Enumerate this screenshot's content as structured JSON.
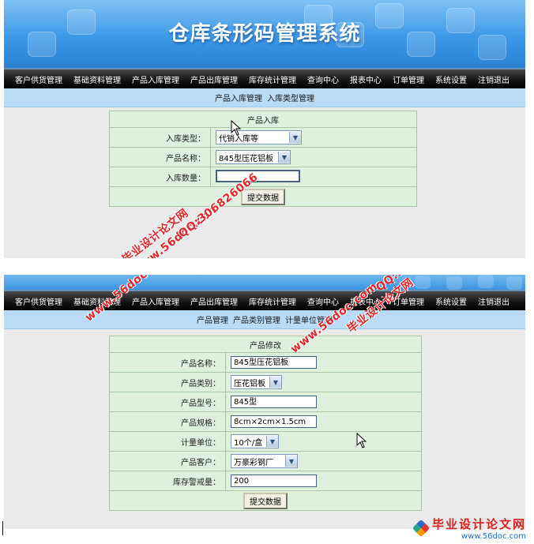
{
  "app_title": "仓库条形码管理系统",
  "nav": [
    "客户供货管理",
    "基础资料管理",
    "产品入库管理",
    "产品出库管理",
    "库存统计管理",
    "查询中心",
    "报表中心",
    "订单管理",
    "系统设置",
    "注销退出"
  ],
  "screen1": {
    "subnav": [
      "产品入库管理",
      "入库类型管理"
    ],
    "form_title": "产品入库",
    "fields": {
      "type_label": "入库类型：",
      "type_value": "代销入库等",
      "name_label": "产品名称：",
      "name_value": "845型压花铝板",
      "qty_label": "入库数量：",
      "qty_value": ""
    },
    "submit": "提交数据"
  },
  "screen2": {
    "subnav": [
      "产品管理",
      "产品类别管理",
      "计量单位管理"
    ],
    "form_title": "产品修改",
    "fields": [
      {
        "label": "产品名称：",
        "value": "845型压花铝板",
        "kind": "input"
      },
      {
        "label": "产品类别：",
        "value": "压花铝板",
        "kind": "select"
      },
      {
        "label": "产品型号：",
        "value": "845型",
        "kind": "input"
      },
      {
        "label": "产品规格：",
        "value": "8cm×2cm×1.5cm",
        "kind": "input"
      },
      {
        "label": "计量单位：",
        "value": "10个/盒",
        "kind": "select"
      },
      {
        "label": "产品客户：",
        "value": "万豪彩钢厂",
        "kind": "select"
      },
      {
        "label": "库存警戒量：",
        "value": "200",
        "kind": "input"
      }
    ],
    "submit": "提交数据"
  },
  "watermarks": {
    "site_a": "毕业设计论文网",
    "url_a": "www.56doc.com",
    "qq": "QQ:306826066"
  },
  "footer": {
    "title": "毕业设计论文网",
    "url": "www.56doc.com"
  },
  "colors": {
    "banner": "#3c98e6",
    "nav_bg": "#111111",
    "subnav_bg": "#b9dbf5",
    "form_bg": "#dff0df",
    "watermark": "#e0282c"
  }
}
